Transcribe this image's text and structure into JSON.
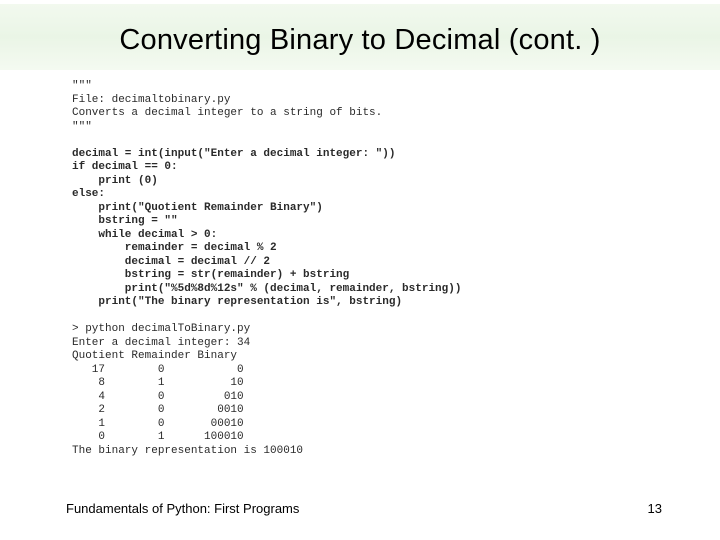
{
  "title": "Converting Binary to Decimal (cont. )",
  "code": {
    "l1": "\"\"\"",
    "l2": "File: decimaltobinary.py",
    "l3": "Converts a decimal integer to a string of bits.",
    "l4": "\"\"\"",
    "l5": "",
    "l6": "decimal = int(input(\"Enter a decimal integer: \"))",
    "l7": "if decimal == 0:",
    "l8": "    print (0)",
    "l9": "else:",
    "l10": "    print(\"Quotient Remainder Binary\")",
    "l11": "    bstring = \"\"",
    "l12": "    while decimal > 0:",
    "l13": "        remainder = decimal % 2",
    "l14": "        decimal = decimal // 2",
    "l15": "        bstring = str(remainder) + bstring",
    "l16": "        print(\"%5d%8d%12s\" % (decimal, remainder, bstring))",
    "l17": "    print(\"The binary representation is\", bstring)",
    "l18": "",
    "l19": "> python decimalToBinary.py",
    "l20": "Enter a decimal integer: 34",
    "l21": "Quotient Remainder Binary",
    "l22": "   17        0           0",
    "l23": "    8        1          10",
    "l24": "    4        0         010",
    "l25": "    2        0        0010",
    "l26": "    1        0       00010",
    "l27": "    0        1      100010",
    "l28": "The binary representation is 100010"
  },
  "footer": {
    "left": "Fundamentals of Python: First Programs",
    "right": "13"
  }
}
